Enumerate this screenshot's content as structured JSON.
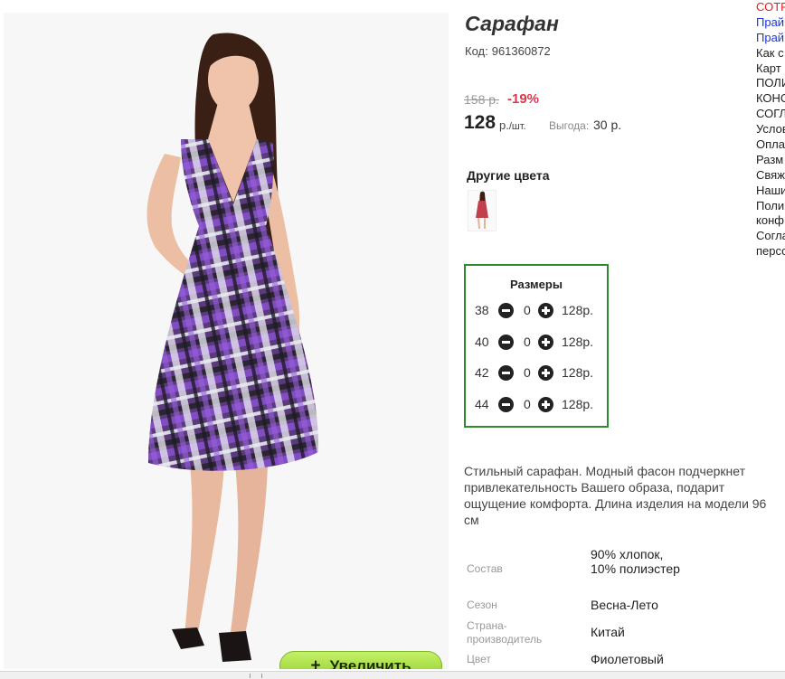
{
  "product": {
    "title": "Сарафан",
    "code_label": "Код:",
    "code_value": "961360872",
    "old_price": "158 р.",
    "discount": "-19%",
    "price": "128",
    "price_unit": "р.",
    "price_per": "/шт.",
    "benefit_label": "Выгода:",
    "benefit_value": "30 р.",
    "zoom_label": "Увеличить",
    "description": "Стильный сарафан. Модный фасон подчеркнет привлекательность Вашего образа, подарит ощущение комфорта. Длина изделия на модели 96 см"
  },
  "colors": {
    "title": "Другие цвета"
  },
  "sizes": {
    "title": "Размеры",
    "rows": [
      {
        "size": "38",
        "qty": "0",
        "price": "128р."
      },
      {
        "size": "40",
        "qty": "0",
        "price": "128р."
      },
      {
        "size": "42",
        "qty": "0",
        "price": "128р."
      },
      {
        "size": "44",
        "qty": "0",
        "price": "128р."
      }
    ]
  },
  "specs": [
    {
      "label": "Состав",
      "value": "90% хлопок, 10% полиэстер"
    },
    {
      "label": "Сезон",
      "value": "Весна-Лето"
    },
    {
      "label": "Страна-производитель",
      "value": "Китай"
    },
    {
      "label": "Цвет",
      "value": "Фиолетовый"
    }
  ],
  "side_links": [
    "СОТР",
    "Прай",
    "Прай",
    "Как с",
    "Карт",
    "ПОЛИ",
    "КОНС",
    "СОГЛ",
    "Услов",
    "Опла",
    "Разм",
    "Свяж",
    "Наши",
    "Поли",
    "конф",
    "Согла",
    "персо"
  ],
  "colors_accent": {
    "discount": "#e0344b",
    "sizes_border": "#2f8a2f",
    "zoom_button": "#9ad834",
    "link_red": "#e02020",
    "link_blue": "#1a35d8"
  }
}
